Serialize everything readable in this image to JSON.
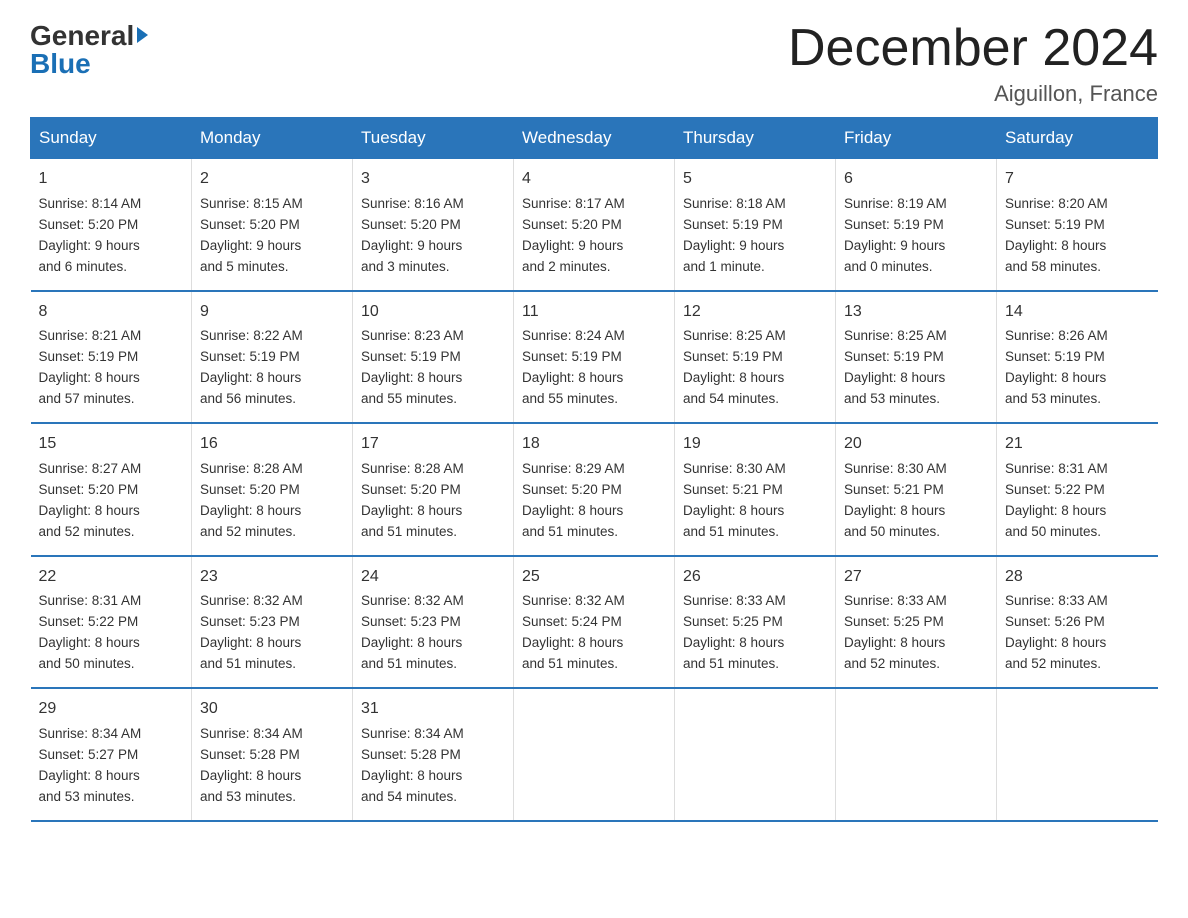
{
  "logo": {
    "line1": "General",
    "arrow": "▶",
    "line2": "Blue"
  },
  "title": "December 2024",
  "location": "Aiguillon, France",
  "days_of_week": [
    "Sunday",
    "Monday",
    "Tuesday",
    "Wednesday",
    "Thursday",
    "Friday",
    "Saturday"
  ],
  "weeks": [
    [
      {
        "day": "1",
        "lines": [
          "Sunrise: 8:14 AM",
          "Sunset: 5:20 PM",
          "Daylight: 9 hours",
          "and 6 minutes."
        ]
      },
      {
        "day": "2",
        "lines": [
          "Sunrise: 8:15 AM",
          "Sunset: 5:20 PM",
          "Daylight: 9 hours",
          "and 5 minutes."
        ]
      },
      {
        "day": "3",
        "lines": [
          "Sunrise: 8:16 AM",
          "Sunset: 5:20 PM",
          "Daylight: 9 hours",
          "and 3 minutes."
        ]
      },
      {
        "day": "4",
        "lines": [
          "Sunrise: 8:17 AM",
          "Sunset: 5:20 PM",
          "Daylight: 9 hours",
          "and 2 minutes."
        ]
      },
      {
        "day": "5",
        "lines": [
          "Sunrise: 8:18 AM",
          "Sunset: 5:19 PM",
          "Daylight: 9 hours",
          "and 1 minute."
        ]
      },
      {
        "day": "6",
        "lines": [
          "Sunrise: 8:19 AM",
          "Sunset: 5:19 PM",
          "Daylight: 9 hours",
          "and 0 minutes."
        ]
      },
      {
        "day": "7",
        "lines": [
          "Sunrise: 8:20 AM",
          "Sunset: 5:19 PM",
          "Daylight: 8 hours",
          "and 58 minutes."
        ]
      }
    ],
    [
      {
        "day": "8",
        "lines": [
          "Sunrise: 8:21 AM",
          "Sunset: 5:19 PM",
          "Daylight: 8 hours",
          "and 57 minutes."
        ]
      },
      {
        "day": "9",
        "lines": [
          "Sunrise: 8:22 AM",
          "Sunset: 5:19 PM",
          "Daylight: 8 hours",
          "and 56 minutes."
        ]
      },
      {
        "day": "10",
        "lines": [
          "Sunrise: 8:23 AM",
          "Sunset: 5:19 PM",
          "Daylight: 8 hours",
          "and 55 minutes."
        ]
      },
      {
        "day": "11",
        "lines": [
          "Sunrise: 8:24 AM",
          "Sunset: 5:19 PM",
          "Daylight: 8 hours",
          "and 55 minutes."
        ]
      },
      {
        "day": "12",
        "lines": [
          "Sunrise: 8:25 AM",
          "Sunset: 5:19 PM",
          "Daylight: 8 hours",
          "and 54 minutes."
        ]
      },
      {
        "day": "13",
        "lines": [
          "Sunrise: 8:25 AM",
          "Sunset: 5:19 PM",
          "Daylight: 8 hours",
          "and 53 minutes."
        ]
      },
      {
        "day": "14",
        "lines": [
          "Sunrise: 8:26 AM",
          "Sunset: 5:19 PM",
          "Daylight: 8 hours",
          "and 53 minutes."
        ]
      }
    ],
    [
      {
        "day": "15",
        "lines": [
          "Sunrise: 8:27 AM",
          "Sunset: 5:20 PM",
          "Daylight: 8 hours",
          "and 52 minutes."
        ]
      },
      {
        "day": "16",
        "lines": [
          "Sunrise: 8:28 AM",
          "Sunset: 5:20 PM",
          "Daylight: 8 hours",
          "and 52 minutes."
        ]
      },
      {
        "day": "17",
        "lines": [
          "Sunrise: 8:28 AM",
          "Sunset: 5:20 PM",
          "Daylight: 8 hours",
          "and 51 minutes."
        ]
      },
      {
        "day": "18",
        "lines": [
          "Sunrise: 8:29 AM",
          "Sunset: 5:20 PM",
          "Daylight: 8 hours",
          "and 51 minutes."
        ]
      },
      {
        "day": "19",
        "lines": [
          "Sunrise: 8:30 AM",
          "Sunset: 5:21 PM",
          "Daylight: 8 hours",
          "and 51 minutes."
        ]
      },
      {
        "day": "20",
        "lines": [
          "Sunrise: 8:30 AM",
          "Sunset: 5:21 PM",
          "Daylight: 8 hours",
          "and 50 minutes."
        ]
      },
      {
        "day": "21",
        "lines": [
          "Sunrise: 8:31 AM",
          "Sunset: 5:22 PM",
          "Daylight: 8 hours",
          "and 50 minutes."
        ]
      }
    ],
    [
      {
        "day": "22",
        "lines": [
          "Sunrise: 8:31 AM",
          "Sunset: 5:22 PM",
          "Daylight: 8 hours",
          "and 50 minutes."
        ]
      },
      {
        "day": "23",
        "lines": [
          "Sunrise: 8:32 AM",
          "Sunset: 5:23 PM",
          "Daylight: 8 hours",
          "and 51 minutes."
        ]
      },
      {
        "day": "24",
        "lines": [
          "Sunrise: 8:32 AM",
          "Sunset: 5:23 PM",
          "Daylight: 8 hours",
          "and 51 minutes."
        ]
      },
      {
        "day": "25",
        "lines": [
          "Sunrise: 8:32 AM",
          "Sunset: 5:24 PM",
          "Daylight: 8 hours",
          "and 51 minutes."
        ]
      },
      {
        "day": "26",
        "lines": [
          "Sunrise: 8:33 AM",
          "Sunset: 5:25 PM",
          "Daylight: 8 hours",
          "and 51 minutes."
        ]
      },
      {
        "day": "27",
        "lines": [
          "Sunrise: 8:33 AM",
          "Sunset: 5:25 PM",
          "Daylight: 8 hours",
          "and 52 minutes."
        ]
      },
      {
        "day": "28",
        "lines": [
          "Sunrise: 8:33 AM",
          "Sunset: 5:26 PM",
          "Daylight: 8 hours",
          "and 52 minutes."
        ]
      }
    ],
    [
      {
        "day": "29",
        "lines": [
          "Sunrise: 8:34 AM",
          "Sunset: 5:27 PM",
          "Daylight: 8 hours",
          "and 53 minutes."
        ]
      },
      {
        "day": "30",
        "lines": [
          "Sunrise: 8:34 AM",
          "Sunset: 5:28 PM",
          "Daylight: 8 hours",
          "and 53 minutes."
        ]
      },
      {
        "day": "31",
        "lines": [
          "Sunrise: 8:34 AM",
          "Sunset: 5:28 PM",
          "Daylight: 8 hours",
          "and 54 minutes."
        ]
      },
      null,
      null,
      null,
      null
    ]
  ]
}
